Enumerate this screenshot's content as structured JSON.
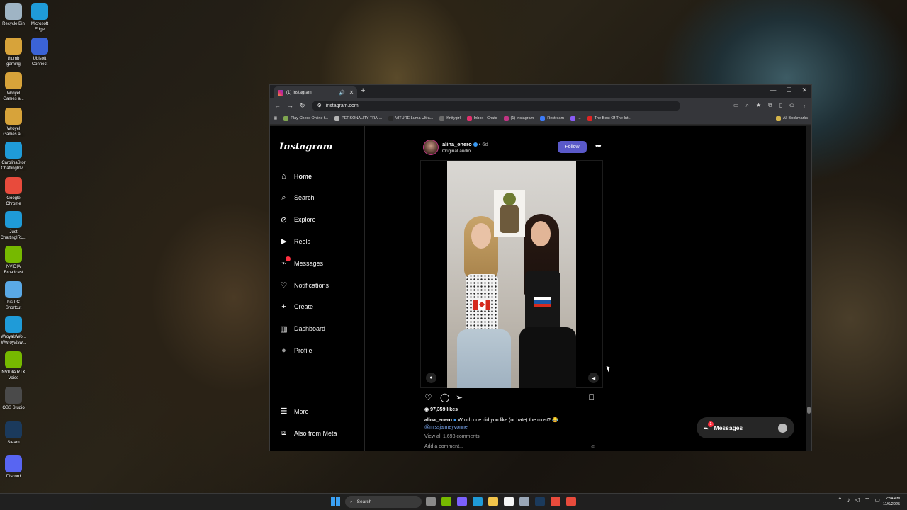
{
  "desktop": {
    "icons": [
      {
        "label": "Recycle Bin",
        "color": "#9fb4c4"
      },
      {
        "label": "Microsoft Edge",
        "color": "#1f9bd8"
      },
      {
        "label": "thumb gaming",
        "color": "#d7a33a"
      },
      {
        "label": "Ubisoft Connect",
        "color": "#3b63d6"
      },
      {
        "label": "Wroyel Games a...",
        "color": "#d7a33a"
      },
      {
        "label": "Wroyel Games a...",
        "color": "#d7a33a"
      },
      {
        "label": "CarolinaStor ChattingIrlv...",
        "color": "#1f9bd8"
      },
      {
        "label": "Google Chrome",
        "color": "#e84b3c"
      },
      {
        "label": "Just ChattingIRL...",
        "color": "#1f9bd8"
      },
      {
        "label": "NVIDIA Broadcast",
        "color": "#76b900"
      },
      {
        "label": "This PC - Shortcut",
        "color": "#5aa9e6"
      },
      {
        "label": "WroyalsWo... Wwroyalsw...",
        "color": "#1f9bd8"
      },
      {
        "label": "NVIDIA RTX Voice",
        "color": "#76b900"
      },
      {
        "label": "OBS Studio",
        "color": "#4a4a4a"
      },
      {
        "label": "Steam",
        "color": "#1b3a5c"
      },
      {
        "label": "Discord",
        "color": "#5865f2"
      }
    ]
  },
  "browser": {
    "tab_title": "(1) Instagram",
    "tab_audio_icon": "speaker-icon",
    "url": "instagram.com",
    "bookmarks": [
      {
        "label": "Play Chess Online f...",
        "color": "#7fa650"
      },
      {
        "label": "PERSONALITY TRAI...",
        "color": "#b5b5b5"
      },
      {
        "label": "VITURE Luma Ultra...",
        "color": "#2a2a2a"
      },
      {
        "label": "Knitygirl",
        "color": "#6a6a6a"
      },
      {
        "label": "Inbox - Chats",
        "color": "#e1306c"
      },
      {
        "label": "(1) Instagram",
        "color": "#c13584"
      },
      {
        "label": "Restream",
        "color": "#3d7bf7"
      },
      {
        "label": "...",
        "color": "#8a5cf6"
      },
      {
        "label": "The Best Of The Int...",
        "color": "#e02424"
      }
    ],
    "all_bookmarks": "All Bookmarks"
  },
  "instagram": {
    "logo": "Instagram",
    "nav": [
      {
        "label": "Home",
        "icon": "home-icon"
      },
      {
        "label": "Search",
        "icon": "search-icon"
      },
      {
        "label": "Explore",
        "icon": "compass-icon"
      },
      {
        "label": "Reels",
        "icon": "reels-icon"
      },
      {
        "label": "Messages",
        "icon": "messenger-icon"
      },
      {
        "label": "Notifications",
        "icon": "heart-icon"
      },
      {
        "label": "Create",
        "icon": "plus-icon"
      },
      {
        "label": "Dashboard",
        "icon": "dashboard-icon"
      },
      {
        "label": "Profile",
        "icon": "avatar"
      }
    ],
    "more": "More",
    "also_from_meta": "Also from Meta",
    "post": {
      "username": "alina_enero",
      "age": "6d",
      "audio": "Original audio",
      "follow": "Follow",
      "likes": "97,359 likes",
      "caption_user": "alina_enero",
      "caption_text": "Which one did you like (or hate) the most? 😂",
      "mention": "@missjaimeyvonne",
      "view_all": "View all 1,698 comments",
      "add_comment": "Add a comment..."
    },
    "messages_pill": {
      "label": "Messages",
      "badge": "1"
    }
  },
  "taskbar": {
    "search": "Search",
    "apps": [
      {
        "name": "task-view",
        "color": "#8a8a8a"
      },
      {
        "name": "nvidia",
        "color": "#76b900"
      },
      {
        "name": "copilot",
        "color": "#7b61ff"
      },
      {
        "name": "edge",
        "color": "#1f9bd8"
      },
      {
        "name": "file-explorer",
        "color": "#f2c44b"
      },
      {
        "name": "store",
        "color": "#f4f4f4"
      },
      {
        "name": "settings",
        "color": "#9aa7b8"
      },
      {
        "name": "steam",
        "color": "#1b3a5c"
      },
      {
        "name": "tool",
        "color": "#e84b3c"
      },
      {
        "name": "chrome",
        "color": "#e84b3c"
      }
    ],
    "time": "2:54 AM",
    "date": "11/6/2025"
  }
}
